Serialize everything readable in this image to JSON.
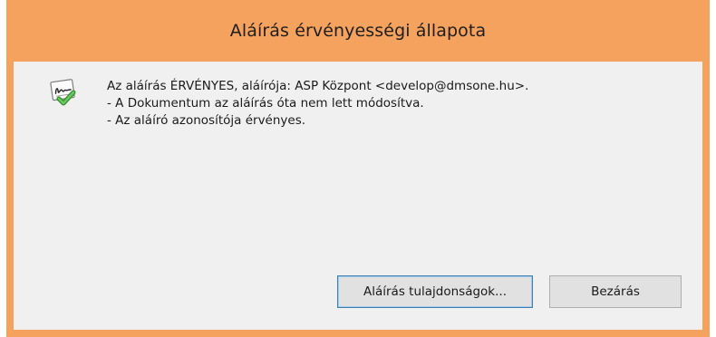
{
  "window": {
    "title": "Aláírás érvényességi állapota"
  },
  "dialog": {
    "icon": "signature-valid-icon",
    "lines": [
      "Az aláírás ÉRVÉNYES, aláírója: ASP Központ <develop@dmsone.hu>.",
      "- A Dokumentum az aláírás óta nem lett módosítva.",
      "- Az aláíró azonosítója érvényes."
    ]
  },
  "buttons": {
    "properties_label": "Aláírás tulajdonságok...",
    "close_label": "Bezárás"
  },
  "colors": {
    "titlebar": "#f6a25f",
    "client": "#f0f0f0",
    "check": "#3aa335"
  }
}
